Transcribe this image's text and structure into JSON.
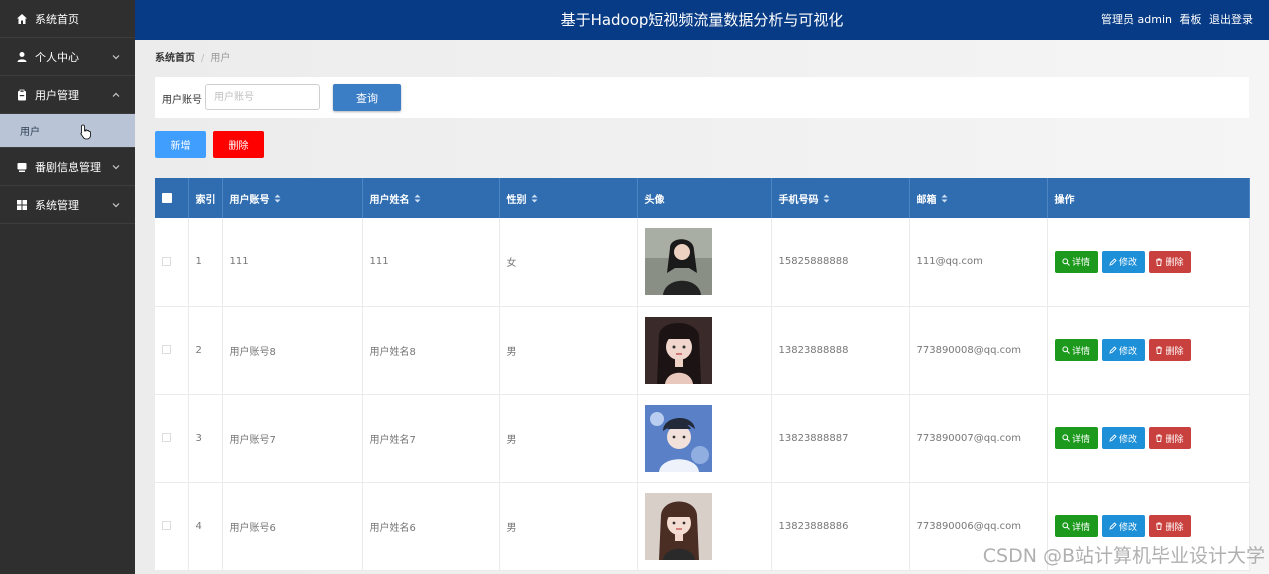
{
  "sidebar": {
    "items": [
      {
        "label": "系统首页",
        "icon": "home-icon",
        "chevron": false
      },
      {
        "label": "个人中心",
        "icon": "user-icon",
        "chevron": true
      },
      {
        "label": "用户管理",
        "icon": "clipboard-icon",
        "chevron": true
      },
      {
        "label": "番剧信息管理",
        "icon": "tv-icon",
        "chevron": true
      },
      {
        "label": "系统管理",
        "icon": "grid-icon",
        "chevron": true
      }
    ],
    "sub_item": "用户"
  },
  "header": {
    "title": "基于Hadoop短视频流量数据分析与可视化",
    "user": "管理员 admin",
    "dashboard": "看板",
    "logout": "退出登录"
  },
  "breadcrumb": {
    "home": "系统首页",
    "current": "用户"
  },
  "search": {
    "label": "用户账号",
    "placeholder": "用户账号",
    "query_button": "查询"
  },
  "actions": {
    "add": "新增",
    "delete": "删除"
  },
  "table": {
    "columns": [
      "索引",
      "用户账号",
      "用户姓名",
      "性别",
      "头像",
      "手机号码",
      "邮箱",
      "操作"
    ],
    "rows": [
      {
        "index": "1",
        "account": "111",
        "name": "111",
        "gender": "女",
        "phone": "15825888888",
        "email": "111@qq.com"
      },
      {
        "index": "2",
        "account": "用户账号8",
        "name": "用户姓名8",
        "gender": "男",
        "phone": "13823888888",
        "email": "773890008@qq.com"
      },
      {
        "index": "3",
        "account": "用户账号7",
        "name": "用户姓名7",
        "gender": "男",
        "phone": "13823888887",
        "email": "773890007@qq.com"
      },
      {
        "index": "4",
        "account": "用户账号6",
        "name": "用户姓名6",
        "gender": "男",
        "phone": "13823888886",
        "email": "773890006@qq.com"
      }
    ],
    "op_labels": {
      "detail": "详情",
      "edit": "修改",
      "delete": "删除"
    }
  },
  "watermark": "CSDN @B站计算机毕业设计大学",
  "colors": {
    "header": "#083b86",
    "sidebar": "#2f2f2f",
    "table_head": "#2f6db0",
    "detail": "#1d9a1d",
    "edit": "#1e90d8",
    "danger": "#c9413e"
  }
}
